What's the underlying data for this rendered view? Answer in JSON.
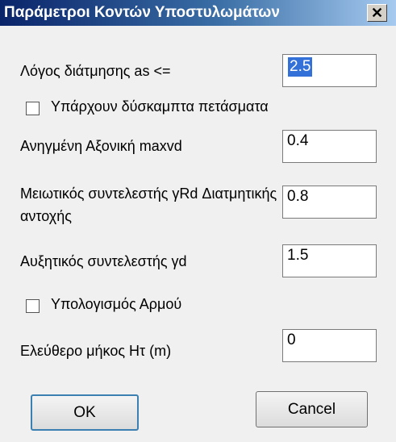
{
  "window": {
    "title": "Παράμετροι Κοντών Υποστυλωμάτων",
    "close_glyph": "✕"
  },
  "form": {
    "shear_ratio": {
      "label": "Λόγος διάτμησης as <=",
      "value": "2.5"
    },
    "stiff_walls": {
      "label": "Υπάρχουν δύσκαμπτα πετάσματα",
      "checked": false
    },
    "axial": {
      "label": "Ανηγμένη Αξονική maxvd",
      "value": "0.4"
    },
    "reduction": {
      "label": "Μειωτικός συντελεστής γRd Διατμητικής αντοχής",
      "value": "0.8"
    },
    "increase": {
      "label": "Αυξητικός συντελεστής γd",
      "value": "1.5"
    },
    "joint_calc": {
      "label": "Υπολογισμός Αρμού",
      "checked": false
    },
    "free_length": {
      "label": "Ελεύθερο μήκος Ητ (m)",
      "value": "0"
    }
  },
  "buttons": {
    "ok": "OK",
    "cancel": "Cancel"
  }
}
